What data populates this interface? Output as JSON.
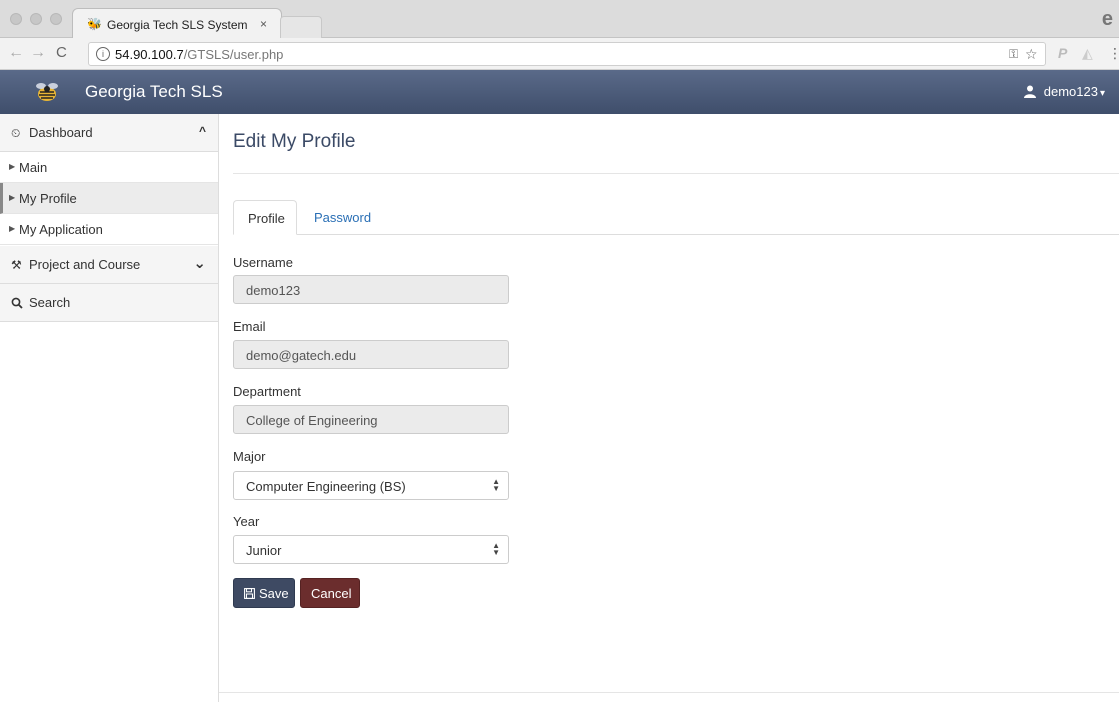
{
  "browser": {
    "tab_title": "Georgia Tech SLS System",
    "tab_close": "×",
    "profile_glyph": "e",
    "url_host": "54.90.100.7",
    "url_path": "/GTSLS/user.php",
    "back_glyph": "←",
    "forward_glyph": "→",
    "reload_glyph": "C",
    "info_glyph": "i",
    "toolbar_icons": [
      "key-icon",
      "star-icon",
      "paypal-icon",
      "extension-icon",
      "menu-icon"
    ]
  },
  "navbar": {
    "brand": "Georgia Tech SLS",
    "user": "demo123",
    "caret": "▾",
    "bg_top": "#5a6a89",
    "bg_bottom": "#3f4e6b"
  },
  "sidebar": {
    "dashboard": {
      "label": "Dashboard",
      "icon": "dashboard-icon",
      "chevron": "^"
    },
    "items": [
      {
        "label": "Main",
        "active": false
      },
      {
        "label": "My Profile",
        "active": true
      },
      {
        "label": "My Application",
        "active": false
      }
    ],
    "project": {
      "label": "Project and Course",
      "icon": "wrench-icon",
      "chevron": "⌄"
    },
    "search": {
      "label": "Search",
      "icon": "search-icon"
    }
  },
  "main": {
    "title": "Edit My Profile",
    "tabs": [
      {
        "label": "Profile",
        "active": true
      },
      {
        "label": "Password",
        "active": false
      }
    ],
    "fields": {
      "username": {
        "label": "Username",
        "value": "demo123"
      },
      "email": {
        "label": "Email",
        "value": "demo@gatech.edu"
      },
      "department": {
        "label": "Department",
        "value": "College of Engineering"
      },
      "major": {
        "label": "Major",
        "value": "Computer Engineering (BS)"
      },
      "year": {
        "label": "Year",
        "value": "Junior"
      }
    },
    "save_label": "Save",
    "cancel_label": "Cancel",
    "save_color": "#3e4a63",
    "cancel_color": "#6b2d2d",
    "link_color": "#2a6fb5"
  }
}
